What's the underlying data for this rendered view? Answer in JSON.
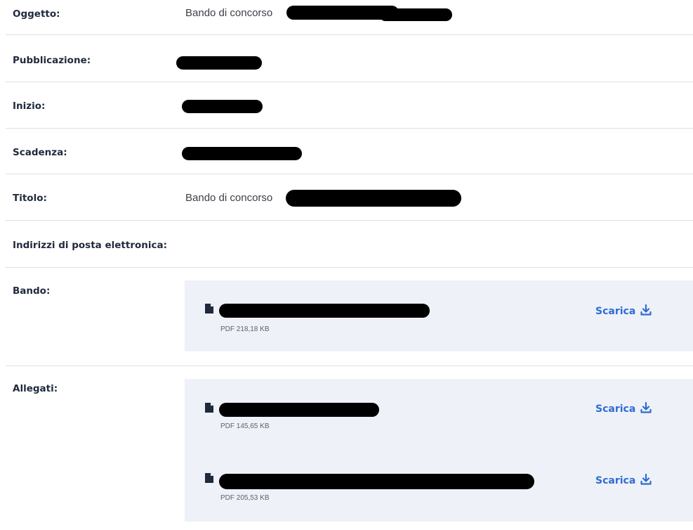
{
  "fields": {
    "oggetto": {
      "label": "Oggetto:",
      "value": "Bando di concorso"
    },
    "pubblicazione": {
      "label": "Pubblicazione:"
    },
    "inizio": {
      "label": "Inizio:"
    },
    "scadenza": {
      "label": "Scadenza:"
    },
    "titolo": {
      "label": "Titolo:",
      "value": "Bando di concorso"
    },
    "indirizzi": {
      "label": "Indirizzi di posta elettronica:"
    },
    "bando": {
      "label": "Bando:"
    },
    "allegati": {
      "label": "Allegati:"
    }
  },
  "bando_files": [
    {
      "meta": "PDF 218,18 KB",
      "action": "Scarica"
    }
  ],
  "allegati_files": [
    {
      "meta": "PDF 145,65 KB",
      "action": "Scarica"
    },
    {
      "meta": "PDF 205,53 KB",
      "action": "Scarica"
    }
  ],
  "colors": {
    "accent": "#2f6cd3",
    "file_box_bg": "#eef1f7",
    "divider": "#d9e0ea",
    "label_text": "#1f2a3c"
  },
  "icons": {
    "file": "file-icon",
    "download": "download-icon"
  }
}
